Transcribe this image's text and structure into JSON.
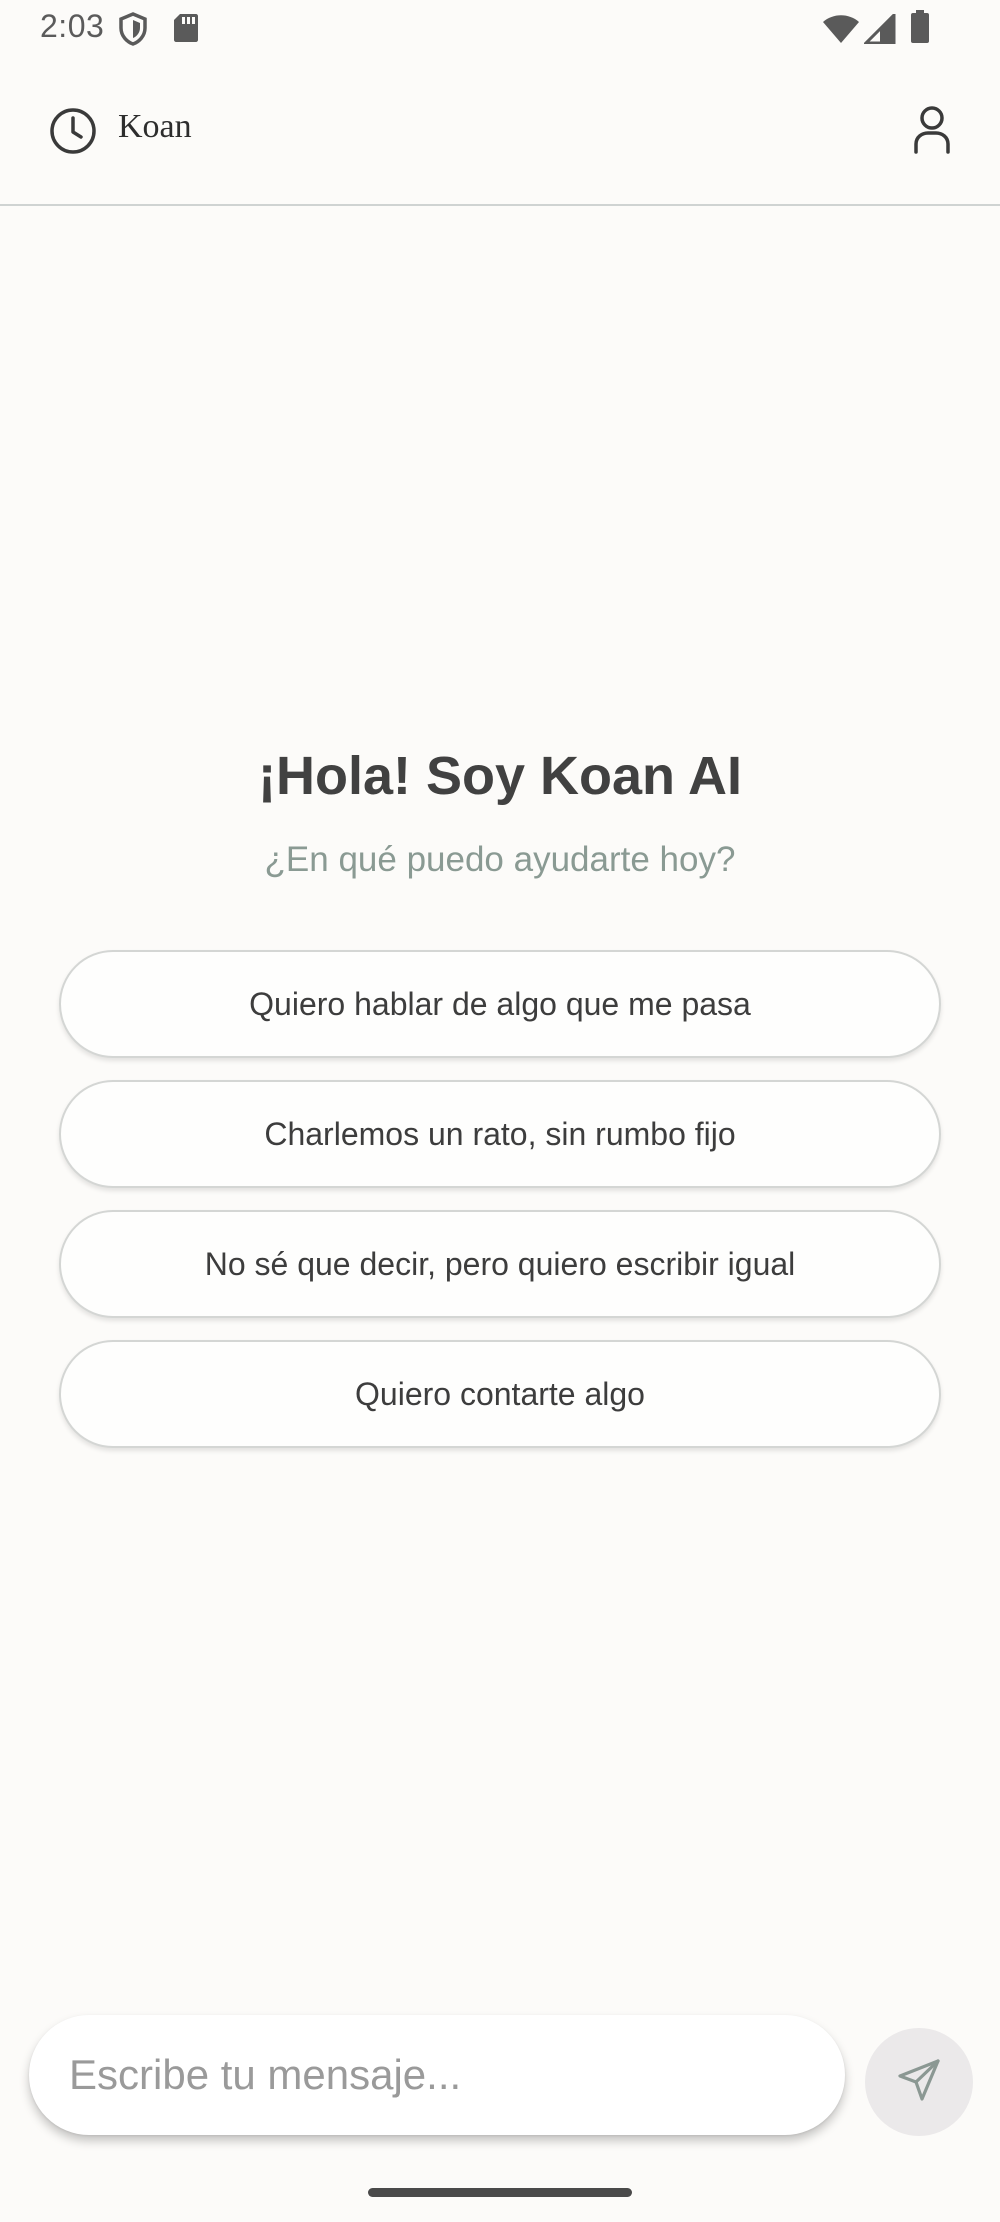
{
  "status_bar": {
    "time": "2:03",
    "icons": [
      "shield-icon",
      "sd-card-icon",
      "wifi-icon",
      "signal-icon",
      "battery-icon"
    ]
  },
  "app_bar": {
    "title": "Koan",
    "left_icon": "history-icon",
    "right_icon": "profile-icon"
  },
  "welcome": {
    "greeting": "¡Hola! Soy Koan AI",
    "subtitle": "¿En qué puedo ayudarte hoy?"
  },
  "suggestions": [
    {
      "label": "Quiero hablar de algo que me pasa"
    },
    {
      "label": "Charlemos un rato, sin rumbo fijo"
    },
    {
      "label": "No sé que decir, pero quiero escribir igual"
    },
    {
      "label": "Quiero contarte algo"
    }
  ],
  "composer": {
    "placeholder": "Escribe tu mensaje...",
    "value": "",
    "send_icon": "send-icon"
  },
  "colors": {
    "background": "#fcfbf9",
    "subtitle": "#8a9a93",
    "send_button_bg": "#ebe9ea"
  }
}
